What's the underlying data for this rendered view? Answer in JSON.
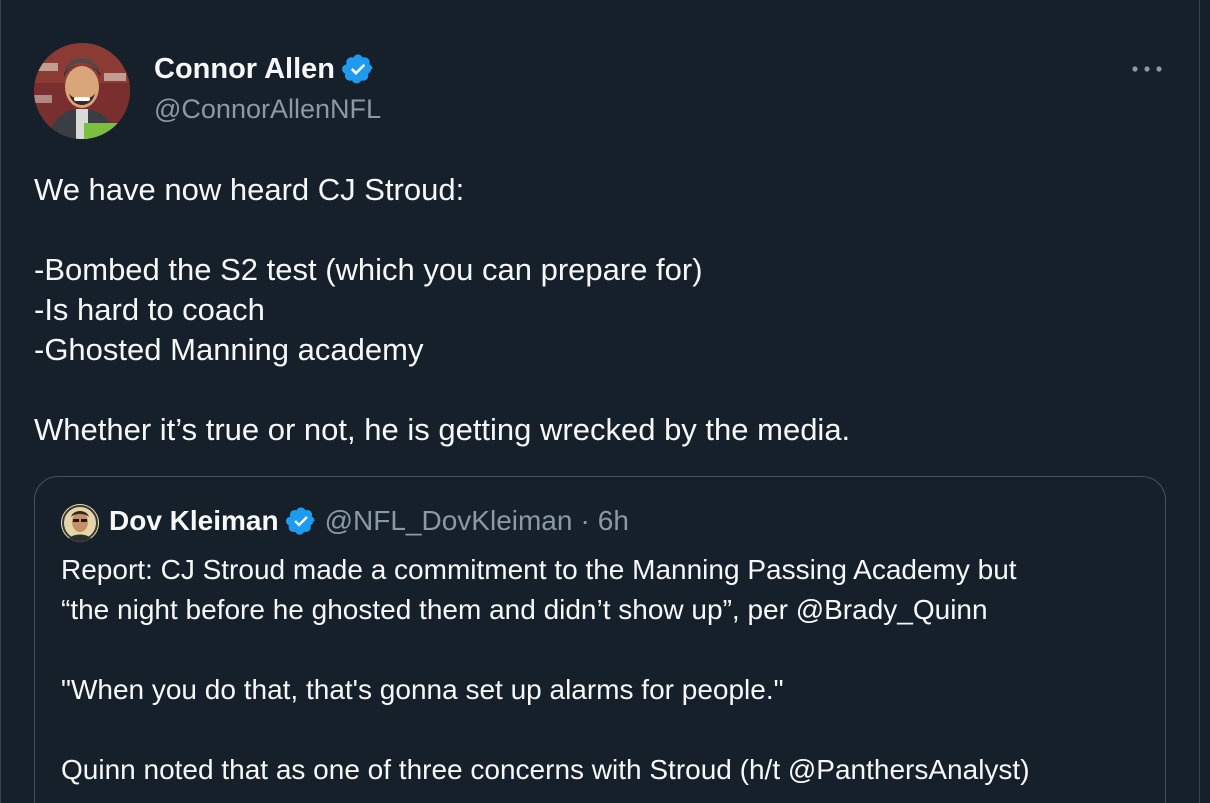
{
  "tweet": {
    "author": {
      "name": "Connor Allen",
      "handle": "@ConnorAllenNFL",
      "verified": true
    },
    "more_menu_icon": "more-horizontal-icon",
    "body_lines": [
      "We have now heard CJ Stroud:",
      "",
      "-Bombed the S2 test (which you can prepare for)",
      "-Is hard to coach",
      "-Ghosted Manning academy",
      "",
      "Whether it’s true or not, he is getting wrecked by the media."
    ]
  },
  "quoted_tweet": {
    "author": {
      "name": "Dov Kleiman",
      "handle": "@NFL_DovKleiman",
      "verified": true
    },
    "separator": "·",
    "time": "6h",
    "body_lines": [
      "Report: CJ Stroud made a commitment to the Manning Passing Academy but",
      "“the night before he ghosted them and didn’t show up”, per @Brady_Quinn",
      "",
      "\"When you do that, that's gonna set up alarms for people.\"",
      "",
      "Quinn noted that as one of three concerns with Stroud (h/t @PanthersAnalyst)"
    ]
  },
  "colors": {
    "background": "#15202b",
    "text_primary": "#f7f9f9",
    "text_secondary": "#8b98a5",
    "verified_blue": "#1d9bf0",
    "border": "#38444d"
  }
}
